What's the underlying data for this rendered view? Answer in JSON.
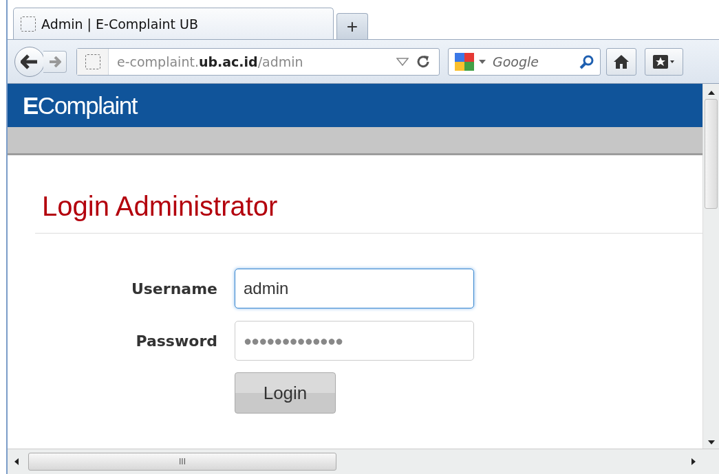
{
  "tabs": [
    {
      "title": "Admin | E-Complaint UB",
      "selected": true
    }
  ],
  "new_tab": "+",
  "address_bar": {
    "url": "e-complaint.**ub.ac.id**/admin"
  },
  "search": {
    "placeholder": "Google"
  },
  "site": {
    "logo": "**E**Complaint"
  },
  "page": {
    "heading": "Login Administrator",
    "fields": [
      {
        "label": "Username",
        "value": "admin",
        "focused": true
      },
      {
        "label": "Password",
        "value": "●●●●●●●●●●●●●",
        "focused": false
      }
    ],
    "button": "Login"
  },
  "scrollbar_grip": "III"
}
